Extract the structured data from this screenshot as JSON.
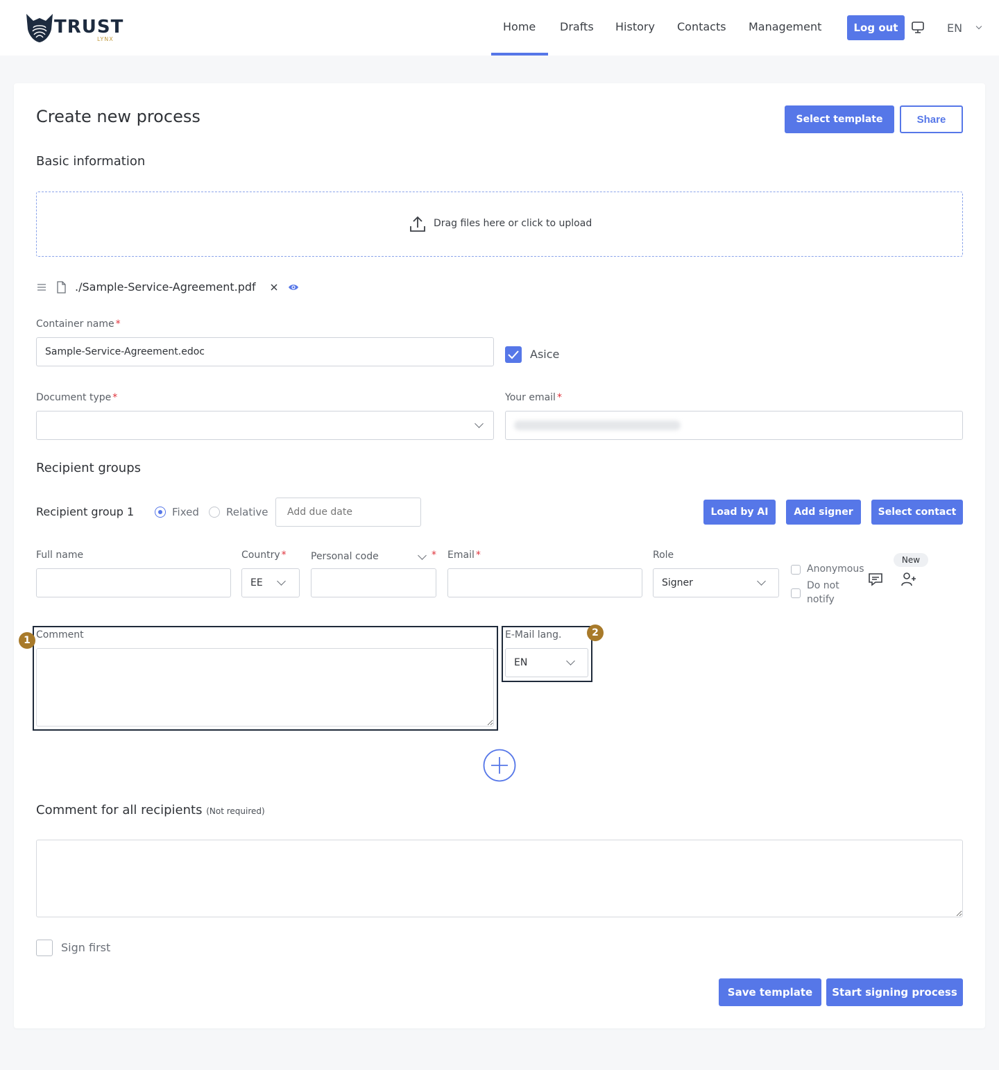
{
  "header": {
    "logo_text": "TRUST",
    "logo_sub": "LYNX",
    "nav": [
      "Home",
      "Drafts",
      "History",
      "Contacts",
      "Management"
    ],
    "active_nav": "Home",
    "logout_label": "Log out",
    "language": "EN"
  },
  "page": {
    "title": "Create new process",
    "select_template_label": "Select template",
    "share_label": "Share"
  },
  "basic": {
    "heading": "Basic information",
    "upload_text": "Drag files here or click to upload",
    "file_name": "./Sample-Service-Agreement.pdf",
    "container_name_label": "Container name",
    "container_name_value": "Sample-Service-Agreement.edoc",
    "asice_label": "Asice",
    "asice_checked": true,
    "document_type_label": "Document type",
    "document_type_value": "",
    "your_email_label": "Your email",
    "required_marker": "*"
  },
  "recipients": {
    "heading": "Recipient groups",
    "group_label": "Recipient group 1",
    "fixed_label": "Fixed",
    "relative_label": "Relative",
    "due_date_placeholder": "Add due date",
    "load_ai_label": "Load by AI",
    "add_signer_label": "Add signer",
    "select_contact_label": "Select contact",
    "full_name_label": "Full name",
    "country_label": "Country",
    "country_value": "EE",
    "personal_code_label": "Personal code",
    "email_label": "Email",
    "role_label": "Role",
    "role_value": "Signer",
    "anonymous_label": "Anonymous",
    "do_not_label": "Do not",
    "notify_label": "notify",
    "new_badge": "New",
    "comment_label": "Comment",
    "email_lang_label": "E-Mail lang.",
    "email_lang_value": "EN",
    "marker_1": "1",
    "marker_2": "2"
  },
  "footer": {
    "comment_all_label": "Comment for all recipients",
    "not_required": "(Not required)",
    "sign_first_label": "Sign first",
    "save_template_label": "Save template",
    "start_signing_label": "Start signing process"
  },
  "colors": {
    "accent": "#5677e8",
    "marker": "#a87a2a",
    "required": "#e0323b",
    "highlight_border": "#1f2a3a"
  }
}
